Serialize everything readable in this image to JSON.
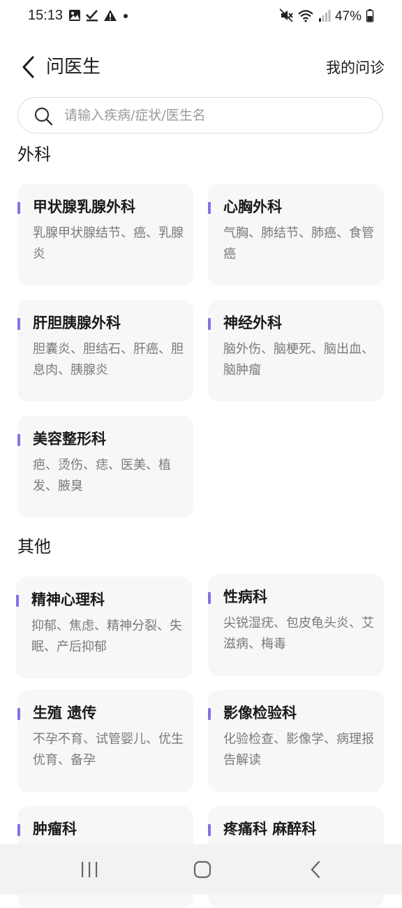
{
  "status_bar": {
    "time": "15:13",
    "battery": "47%",
    "left_icons": [
      "gallery-icon",
      "check-icon",
      "warning-icon",
      "dot-icon"
    ],
    "right_icons": [
      "mute-icon",
      "wifi-icon",
      "signal-icon",
      "battery-icon"
    ]
  },
  "header": {
    "title": "问医生",
    "action": "我的问诊"
  },
  "search": {
    "placeholder": "请输入疾病/症状/医生名"
  },
  "sections": [
    {
      "title": "外科",
      "cards": [
        {
          "name": "甲状腺乳腺外科",
          "desc": "乳腺甲状腺结节、癌、乳腺炎"
        },
        {
          "name": "心胸外科",
          "desc": "气胸、肺结节、肺癌、食管癌"
        },
        {
          "name": "肝胆胰腺外科",
          "desc": "胆囊炎、胆结石、肝癌、胆息肉、胰腺炎"
        },
        {
          "name": "神经外科",
          "desc": "脑外伤、脑梗死、脑出血、脑肿瘤"
        },
        {
          "name": "美容整形科",
          "desc": "疤、烫伤、痣、医美、植发、腋臭"
        }
      ]
    },
    {
      "title": "其他",
      "cards": [
        {
          "name": "精神心理科",
          "desc": "抑郁、焦虑、精神分裂、失眠、产后抑郁"
        },
        {
          "name": "性病科",
          "desc": "尖锐湿疣、包皮龟头炎、艾滋病、梅毒"
        },
        {
          "name": "生殖 遗传",
          "desc": "不孕不育、试管婴儿、优生优育、备孕"
        },
        {
          "name": "影像检验科",
          "desc": "化验检查、影像学、病理报告解读"
        },
        {
          "name": "肿瘤科",
          "desc": ""
        },
        {
          "name": "疼痛科 麻醉科",
          "desc": ""
        }
      ]
    }
  ],
  "accent_color": "#8b6ee8",
  "navbar": [
    "recents-icon",
    "home-icon",
    "back-icon"
  ]
}
